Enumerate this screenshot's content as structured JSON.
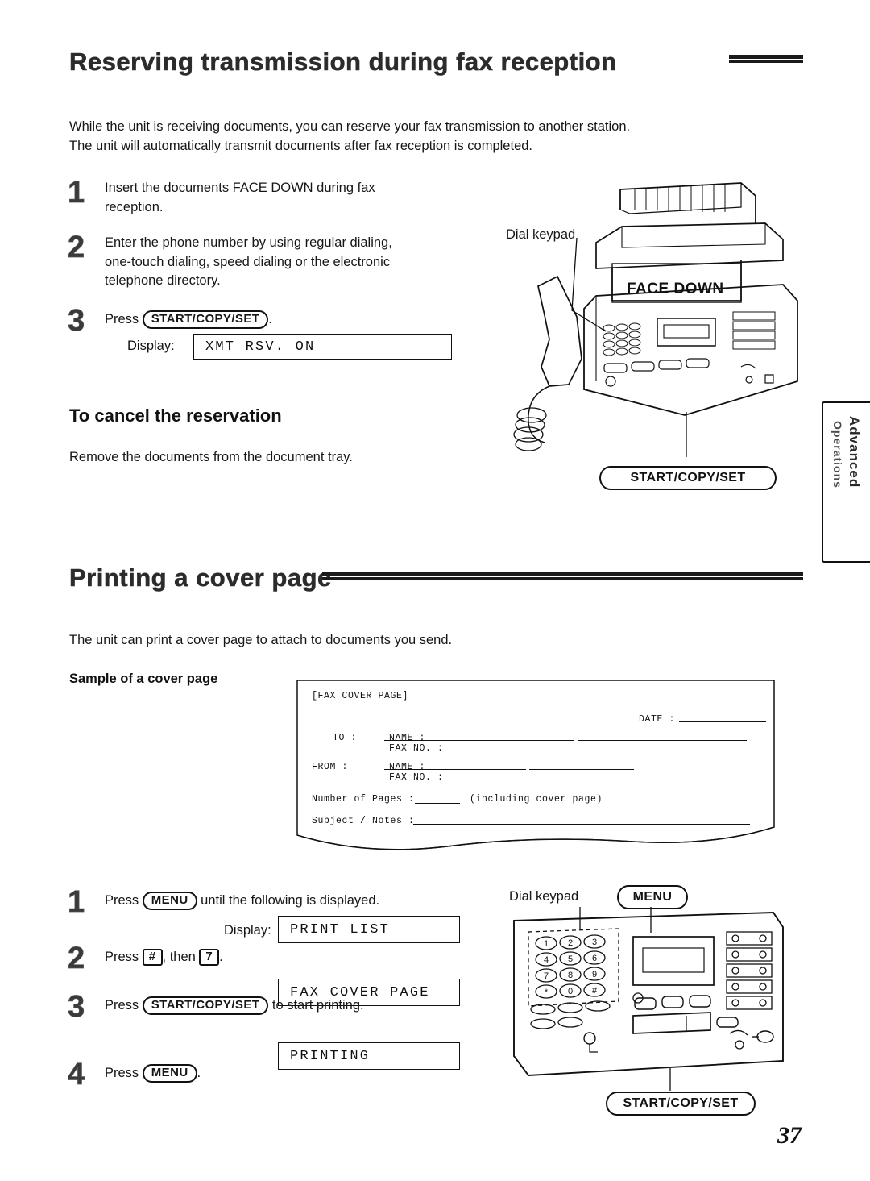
{
  "document": {
    "page_number": "37"
  },
  "section1": {
    "title": "Reserving transmission during fax reception",
    "intro": "While the unit is receiving documents, you can reserve your fax transmission to another station.\nThe unit will automatically transmit documents after fax reception is completed.",
    "steps": [
      {
        "num": "1",
        "text": "Insert the documents FACE DOWN during fax\nreception."
      },
      {
        "num": "2",
        "text": "Enter the phone number by using regular dialing,\none-touch dialing, speed dialing or the electronic\ntelephone directory."
      },
      {
        "num": "3",
        "prefix": "Press",
        "key": "START/COPY/SET",
        "suffix": "."
      }
    ],
    "display_label": "Display:",
    "display_value": "XMT RSV. ON",
    "cancel_heading": "To cancel the reservation",
    "cancel_text": "Remove the documents from the document tray.",
    "figure": {
      "dial_keypad_label": "Dial keypad",
      "face_down_label": "FACE DOWN",
      "button_label": "START/COPY/SET"
    }
  },
  "section2": {
    "title": "Printing a cover page",
    "intro": "The unit can print a cover page to attach to documents you send.",
    "sample_heading": "Sample of a cover page",
    "cover_sample": {
      "title": "[FAX COVER PAGE]",
      "date_label": "DATE :",
      "to_label": "TO :",
      "from_label": "FROM :",
      "name_label": "NAME :",
      "fax_no_label": "FAX NO. :",
      "pages_label": "Number of Pages :",
      "pages_note": "(including cover page)",
      "subject_label": "Subject / Notes :"
    },
    "steps": [
      {
        "num": "1",
        "prefix": "Press",
        "key": "MENU",
        "suffix": "until the following is displayed."
      },
      {
        "num": "2",
        "prefix": "Press",
        "key1": "#",
        "mid": ", then",
        "key2": "7",
        "suffix": "."
      },
      {
        "num": "3",
        "prefix": "Press",
        "key": "START/COPY/SET",
        "suffix": "to start printing."
      },
      {
        "num": "4",
        "prefix": "Press",
        "key": "MENU",
        "suffix": "."
      }
    ],
    "display_label": "Display:",
    "display_values": [
      "PRINT LIST",
      "FAX COVER PAGE",
      "PRINTING"
    ],
    "figure": {
      "dial_keypad_label": "Dial keypad",
      "menu_button_label": "MENU",
      "start_button_label": "START/COPY/SET",
      "keypad_keys": [
        "1",
        "2",
        "3",
        "4",
        "5",
        "6",
        "7",
        "8",
        "9",
        "*",
        "0",
        "#"
      ]
    }
  },
  "side_tab": {
    "line1": "Advanced",
    "line2": "Operations"
  }
}
